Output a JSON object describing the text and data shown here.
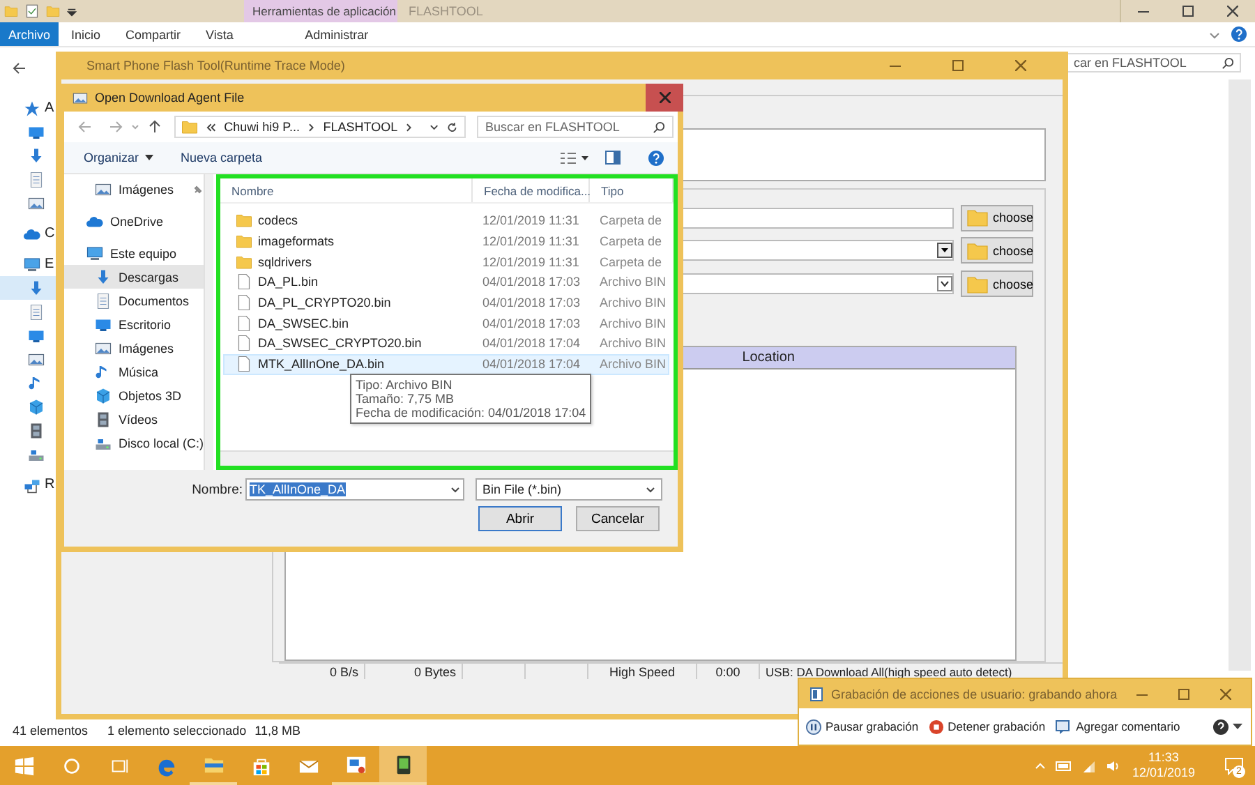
{
  "explorer": {
    "title": "FLASHTOOL",
    "file_tab": "Archivo",
    "tabs": [
      "Inicio",
      "Compartir",
      "Vista"
    ],
    "context_group": "Herramientas de aplicación",
    "context_tabs": [
      "Administrar"
    ],
    "nav": [
      {
        "kind": "star",
        "label": "A",
        "selected": false
      },
      {
        "kind": "desktop",
        "selected": false
      },
      {
        "kind": "downloads",
        "selected": false
      },
      {
        "kind": "documents",
        "selected": false
      },
      {
        "kind": "pictures",
        "selected": false
      },
      {
        "kind": "cloud",
        "label": "C",
        "selected": false
      },
      {
        "kind": "pc",
        "label": "E",
        "selected": false
      },
      {
        "kind": "downloads",
        "selected": true
      },
      {
        "kind": "documents",
        "selected": false
      },
      {
        "kind": "desktop",
        "selected": false
      },
      {
        "kind": "pictures",
        "selected": false
      },
      {
        "kind": "music",
        "selected": false
      },
      {
        "kind": "objects3d",
        "selected": false
      },
      {
        "kind": "videos",
        "selected": false
      },
      {
        "kind": "drive",
        "selected": false
      },
      {
        "kind": "network",
        "label": "R",
        "selected": false
      }
    ],
    "search": {
      "placeholder": "car en FLASHTOOL"
    },
    "status": {
      "count": "41 elementos",
      "selection": "1 elemento seleccionado",
      "size": "11,8 MB"
    }
  },
  "flash_tool": {
    "title": "Smart Phone Flash Tool(Runtime Trace Mode)",
    "file_rows": [
      {
        "kind": "text",
        "button": "choose"
      },
      {
        "kind": "dropdown",
        "button": "choose"
      },
      {
        "kind": "combo",
        "button": "choose"
      }
    ],
    "table": {
      "columns": [
        "Location"
      ]
    },
    "status_bar": [
      "0 B/s",
      "0 Bytes",
      "High Speed",
      "0:00",
      "USB: DA Download All(high speed auto detect)"
    ]
  },
  "dialog": {
    "title": "Open Download Agent File",
    "breadcrumb": [
      "Chuwi hi9 P...",
      "FLASHTOOL"
    ],
    "search": {
      "placeholder": "Buscar en FLASHTOOL"
    },
    "toolbar": {
      "organize": "Organizar",
      "new_folder": "Nueva carpeta"
    },
    "nav": [
      {
        "label": "Imágenes",
        "kind": "pictures",
        "pinned": true,
        "selected": false
      },
      {
        "label": "OneDrive",
        "kind": "cloud",
        "pinned": false,
        "selected": false
      },
      {
        "label": "Este equipo",
        "kind": "pc",
        "pinned": false,
        "selected": false,
        "children": [
          {
            "label": "Descargas",
            "kind": "downloads",
            "selected": true
          },
          {
            "label": "Documentos",
            "kind": "documents",
            "selected": false
          },
          {
            "label": "Escritorio",
            "kind": "desktop",
            "selected": false
          },
          {
            "label": "Imágenes",
            "kind": "pictures",
            "selected": false
          },
          {
            "label": "Música",
            "kind": "music",
            "selected": false
          },
          {
            "label": "Objetos 3D",
            "kind": "objects3d",
            "selected": false
          },
          {
            "label": "Vídeos",
            "kind": "videos",
            "selected": false
          },
          {
            "label": "Disco local (C:)",
            "kind": "drive",
            "selected": false
          }
        ]
      }
    ],
    "columns": [
      "Nombre",
      "Fecha de modifica...",
      "Tipo"
    ],
    "files": [
      {
        "kind": "folder",
        "name": "codecs",
        "date": "12/01/2019 11:31",
        "type": "Carpeta de",
        "hovered": false
      },
      {
        "kind": "folder",
        "name": "imageformats",
        "date": "12/01/2019 11:31",
        "type": "Carpeta de",
        "hovered": false
      },
      {
        "kind": "folder",
        "name": "sqldrivers",
        "date": "12/01/2019 11:31",
        "type": "Carpeta de",
        "hovered": false
      },
      {
        "kind": "file",
        "name": "DA_PL.bin",
        "date": "04/01/2018 17:03",
        "type": "Archivo BIN",
        "hovered": false
      },
      {
        "kind": "file",
        "name": "DA_PL_CRYPTO20.bin",
        "date": "04/01/2018 17:03",
        "type": "Archivo BIN",
        "hovered": false
      },
      {
        "kind": "file",
        "name": "DA_SWSEC.bin",
        "date": "04/01/2018 17:03",
        "type": "Archivo BIN",
        "hovered": false
      },
      {
        "kind": "file",
        "name": "DA_SWSEC_CRYPTO20.bin",
        "date": "04/01/2018 17:04",
        "type": "Archivo BIN",
        "hovered": false
      },
      {
        "kind": "file",
        "name": "MTK_AllInOne_DA.bin",
        "date": "04/01/2018 17:04",
        "type": "Archivo BIN",
        "hovered": true
      }
    ],
    "tooltip": [
      "Tipo: Archivo BIN",
      "Tamaño: 7,75 MB",
      "Fecha de modificación: 04/01/2018 17:04"
    ],
    "highlight": true,
    "filename": {
      "label": "Nombre:",
      "value": "TK_AllInOne_DA"
    },
    "filter": "Bin File (*.bin)",
    "buttons": [
      "Abrir",
      "Cancelar"
    ]
  },
  "recorder": {
    "title": "Grabación de acciones de usuario: grabando ahora",
    "buttons": [
      {
        "kind": "pause",
        "label": "Pausar grabación"
      },
      {
        "kind": "stop",
        "label": "Detener grabación"
      },
      {
        "kind": "comment",
        "label": "Agregar comentario"
      }
    ]
  },
  "taskbar": {
    "apps": [
      {
        "kind": "start",
        "running": false,
        "active": false
      },
      {
        "kind": "search",
        "running": false,
        "active": false
      },
      {
        "kind": "taskview",
        "running": false,
        "active": false
      },
      {
        "kind": "edge",
        "running": false,
        "active": false
      },
      {
        "kind": "explorer",
        "running": true,
        "active": false
      },
      {
        "kind": "store",
        "running": false,
        "active": false
      },
      {
        "kind": "mail",
        "running": false,
        "active": false
      },
      {
        "kind": "viewer",
        "running": true,
        "active": false
      },
      {
        "kind": "flashtool",
        "running": true,
        "active": true
      }
    ],
    "time": "11:33",
    "date": "12/01/2019",
    "notifications": "2"
  }
}
